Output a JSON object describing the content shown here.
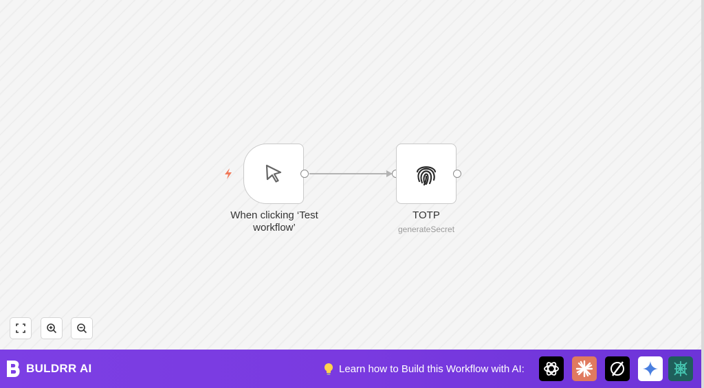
{
  "nodes": [
    {
      "id": "trigger",
      "label": "When clicking ‘Test workflow’",
      "icon": "cursor-arrow-icon"
    },
    {
      "id": "totp",
      "label": "TOTP",
      "subtitle": "generateSecret",
      "icon": "fingerprint-icon"
    }
  ],
  "controls": {
    "fit_view": "fit-view-icon",
    "zoom_in": "zoom-in-icon",
    "zoom_out": "zoom-out-icon"
  },
  "footer": {
    "brand": "BULDRR AI",
    "cta": "Learn how to Build this Workflow with AI:",
    "ai_tools": [
      {
        "name": "chatgpt",
        "color": "#000000"
      },
      {
        "name": "claude",
        "color": "#e07a5f"
      },
      {
        "name": "perplexity",
        "color": "#000000"
      },
      {
        "name": "gemini",
        "color": "#ffffff"
      },
      {
        "name": "deepseek",
        "color": "#1f5f5b"
      }
    ]
  },
  "colors": {
    "footer_bg": "#7c3fe4",
    "trigger_bolt": "#f07a5a",
    "edge": "#b3b3b3"
  }
}
